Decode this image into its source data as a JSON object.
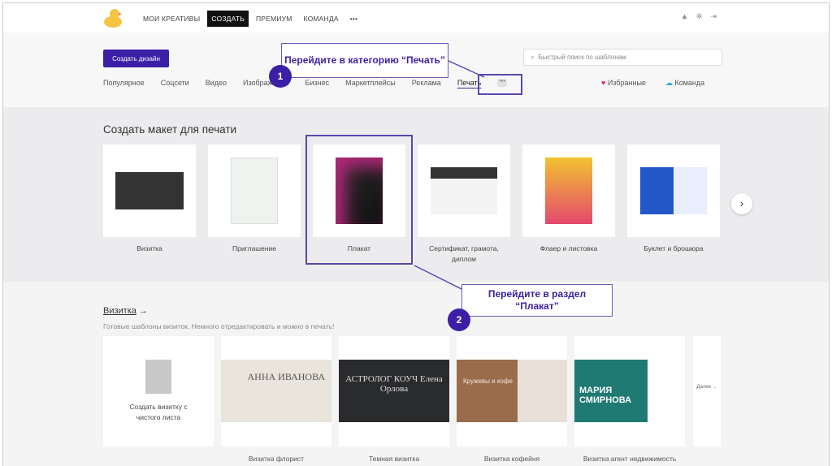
{
  "nav": {
    "items": [
      "МОИ КРЕАТИВЫ",
      "СОЗДАТЬ",
      "ПРЕМИУМ",
      "КОМАНДА"
    ],
    "active": "СОЗДАТЬ",
    "more": "•••"
  },
  "header": {
    "create_button": "Создать дизайн",
    "search_placeholder": "Быстрый поиск по шаблонам",
    "categories": [
      "Популярное",
      "Соцсети",
      "Видео",
      "Изображения",
      "Бизнес",
      "Маркетплейсы",
      "Реклама",
      "Печать"
    ],
    "selected_category": "Печать",
    "favorites": "Избранные",
    "team": "Команда"
  },
  "print": {
    "title": "Создать макет для печати",
    "cards": [
      "Визитка",
      "Приглашение",
      "Плакат",
      "Сертификат, грамота, диплом",
      "Флаер и листовка",
      "Буклет и брошюра"
    ]
  },
  "section": {
    "title": "Визитка",
    "arrow": "→",
    "subtitle": "Готовые шаблоны визиток. Немного отредактировать и можно в печать!",
    "blank_card": "Создать визитку с чистого листа",
    "more": "Далее →",
    "templates": [
      {
        "label": "Визитка флорист",
        "text": "АННА ИВАНОВА",
        "color": "#e9e4dc"
      },
      {
        "label": "Темная визитка",
        "text": "АСТРОЛОГ КОУЧ Елена Орлова",
        "color": "#2a2b2d"
      },
      {
        "label": "Визитка кофейня",
        "text": "Кружевы и кофе",
        "color": "#9a6c4c"
      },
      {
        "label": "Визитка агент недвижимость",
        "text": "МАРИЯ СМИРНОВА",
        "color": "#1f7a73"
      }
    ]
  },
  "callouts": [
    {
      "num": "1",
      "text": "Перейдите в категорию “Печать”"
    },
    {
      "num": "2",
      "text": "Перейдите в раздел “Плакат”"
    }
  ],
  "colors": {
    "accent": "#3b1fa6"
  }
}
